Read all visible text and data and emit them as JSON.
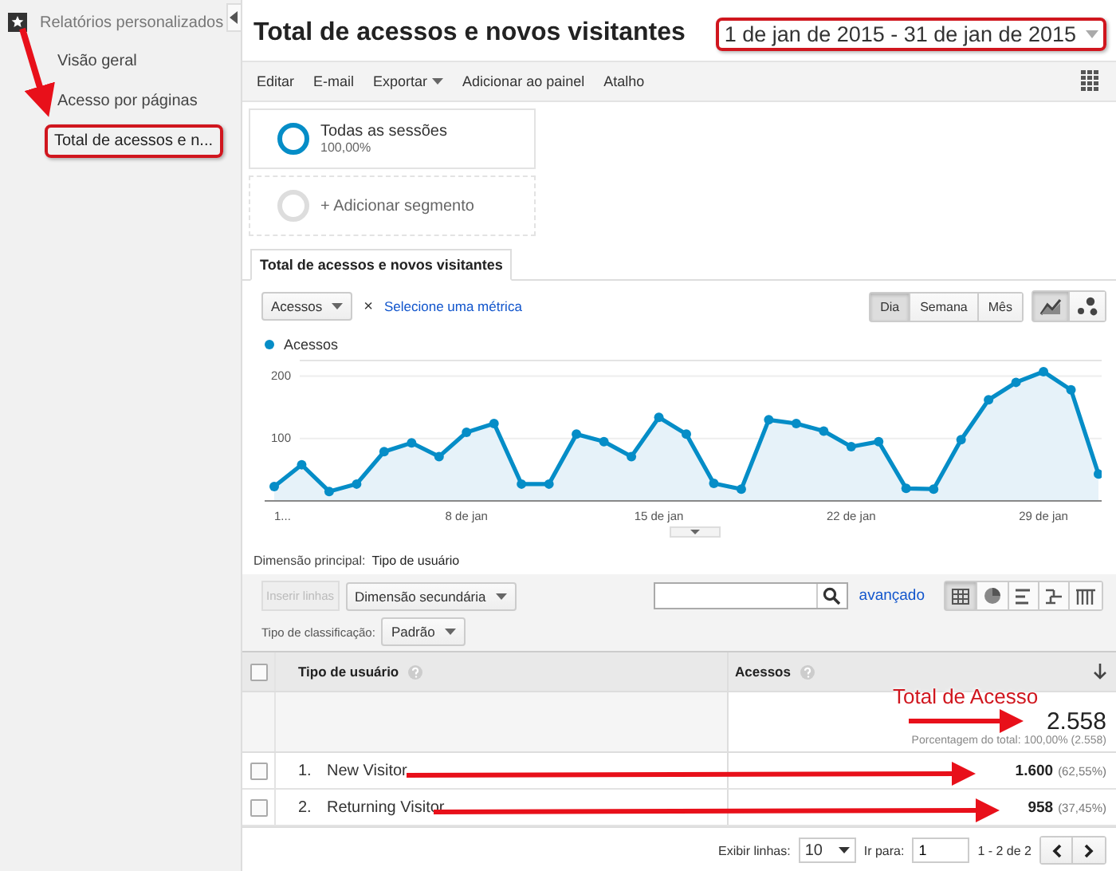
{
  "sidebar": {
    "section": "Relatórios personalizados",
    "items": [
      {
        "label": "Visão geral",
        "highlighted": false
      },
      {
        "label": "Acesso por páginas",
        "highlighted": false
      },
      {
        "label": "Total de acessos e n...",
        "highlighted": true
      }
    ]
  },
  "report": {
    "title": "Total de acessos e novos visitantes",
    "date_range": {
      "text": "1 de jan de 2015 - 31 de jan de 2015",
      "highlighted": true
    }
  },
  "toolbar": [
    {
      "label": "Editar",
      "dropdown": false
    },
    {
      "label": "E-mail",
      "dropdown": false
    },
    {
      "label": "Exportar",
      "dropdown": true
    },
    {
      "label": "Adicionar ao painel",
      "dropdown": false
    },
    {
      "label": "Atalho",
      "dropdown": false
    }
  ],
  "segments": [
    {
      "label": "Todas as sessões",
      "detail": "100,00%",
      "active": true
    },
    {
      "label": "+ Adicionar segmento",
      "active": false
    }
  ],
  "tab": "Total de acessos e novos visitantes",
  "metric": {
    "value": "Acessos",
    "remove": "×",
    "link": "Selecione uma métrica"
  },
  "periods": [
    {
      "label": "Dia",
      "selected": true
    },
    {
      "label": "Semana",
      "selected": false
    },
    {
      "label": "Mês",
      "selected": false
    }
  ],
  "chart_types": [
    {
      "kind": "line",
      "selected": true
    },
    {
      "kind": "dots",
      "selected": false
    }
  ],
  "chart": {
    "chart_data": {
      "type": "area",
      "categories": [
        "1...",
        null,
        null,
        null,
        null,
        null,
        null,
        "8 de jan",
        null,
        null,
        null,
        null,
        null,
        null,
        "15 de jan",
        null,
        null,
        null,
        null,
        null,
        null,
        "22 de jan",
        null,
        null,
        null,
        null,
        null,
        null,
        "29 de jan",
        null,
        null
      ],
      "series": [
        {
          "name": "Acessos",
          "color": "#058dc7",
          "values": [
            23,
            58,
            15,
            27,
            79,
            93,
            71,
            110,
            124,
            27,
            27,
            107,
            95,
            71,
            134,
            107,
            28,
            19,
            130,
            124,
            112,
            87,
            95,
            20,
            19,
            98,
            162,
            190,
            207,
            178,
            43
          ]
        }
      ],
      "ylim": [
        0,
        225
      ],
      "yticks": [
        100,
        200
      ]
    }
  },
  "dimension": {
    "label": "Dimensão principal:",
    "value": "Tipo de usuário"
  },
  "table_controls": {
    "add_rows": {
      "label": "Inserir linhas",
      "disabled": true
    },
    "secondary": "Dimensão secundária",
    "advanced": "avançado",
    "sort_label": "Tipo de classificação:",
    "sort_value": "Padrão",
    "views": [
      {
        "kind": "table",
        "selected": true
      },
      {
        "kind": "pie",
        "selected": false
      },
      {
        "kind": "bars",
        "selected": false
      },
      {
        "kind": "comparison",
        "selected": false
      },
      {
        "kind": "pivot",
        "selected": false
      }
    ]
  },
  "table": {
    "select_all": {
      "checked": false
    },
    "columns": [
      "Tipo de usuário",
      "Acessos"
    ],
    "totals": {
      "value": "2.558",
      "note": "Porcentagem do total: 100,00% (2.558)"
    },
    "rows": [
      {
        "index": "1.",
        "name": "New Visitor",
        "value": "1.600",
        "share": "(62,55%)",
        "checked": false
      },
      {
        "index": "2.",
        "name": "Returning Visitor",
        "value": "958",
        "share": "(37,45%)",
        "checked": false
      }
    ]
  },
  "pagination": {
    "rows_label": "Exibir linhas:",
    "rows_value": "10",
    "goto_label": "Ir para:",
    "goto_value": "1",
    "range": "1 - 2 de 2"
  },
  "annotations": [
    {
      "text": "Total de Acesso"
    }
  ]
}
